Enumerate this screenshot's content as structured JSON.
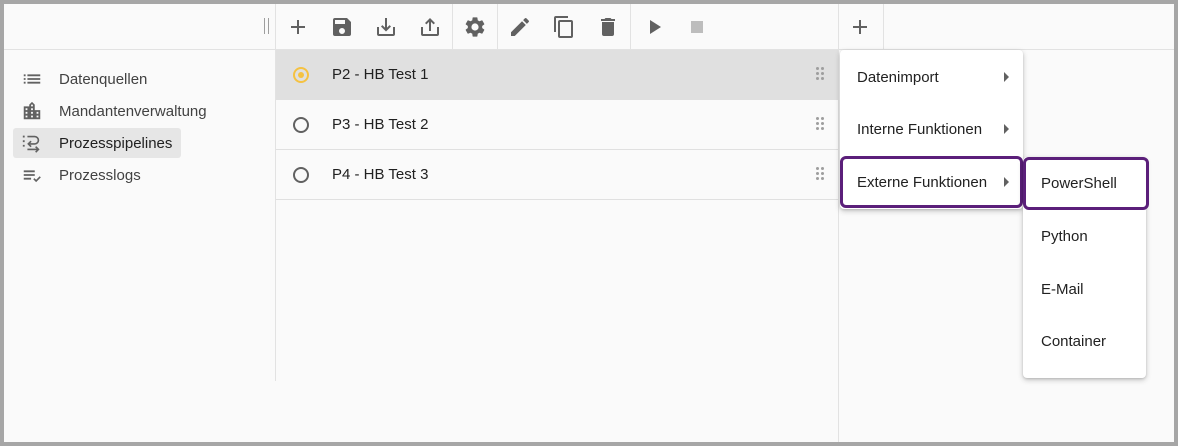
{
  "toolbar": {
    "buttons": [
      "add-icon",
      "save-icon",
      "download-icon",
      "upload-icon",
      "settings-icon",
      "edit-icon",
      "copy-icon",
      "delete-icon",
      "play-icon",
      "stop-icon"
    ],
    "right_add": "add-icon"
  },
  "sidebar": {
    "items": [
      {
        "label": "Datenquellen",
        "icon": "list-icon"
      },
      {
        "label": "Mandantenverwaltung",
        "icon": "building-icon"
      },
      {
        "label": "Prozesspipelines",
        "icon": "pipeline-icon",
        "active": true
      },
      {
        "label": "Prozesslogs",
        "icon": "checklist-icon"
      }
    ]
  },
  "pipelines": [
    {
      "title": "P2 - HB Test 1",
      "selected": true
    },
    {
      "title": "P3 - HB Test 2",
      "selected": false
    },
    {
      "title": "P4 - HB Test 3",
      "selected": false
    }
  ],
  "menu": {
    "items": [
      {
        "label": "Datenimport"
      },
      {
        "label": "Interne Funktionen"
      },
      {
        "label": "Externe Funktionen",
        "highlighted": true
      }
    ],
    "submenu": [
      {
        "label": "PowerShell",
        "highlighted": true
      },
      {
        "label": "Python"
      },
      {
        "label": "E-Mail"
      },
      {
        "label": "Container"
      }
    ]
  },
  "colors": {
    "highlight": "#5b1f7a",
    "radio_selected": "#f5c242",
    "selected_row": "#e0e0e0"
  }
}
